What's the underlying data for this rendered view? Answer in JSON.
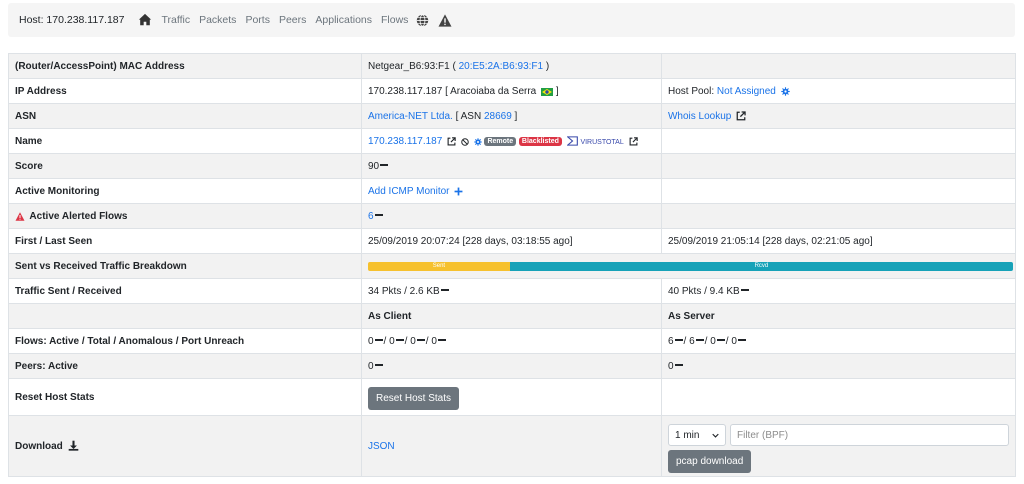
{
  "header": {
    "host_title": "Host: 170.238.117.187",
    "nav": [
      "Traffic",
      "Packets",
      "Ports",
      "Peers",
      "Applications",
      "Flows"
    ]
  },
  "rows": {
    "mac": {
      "label": "(Router/AccessPoint) MAC Address",
      "prefix": "Netgear_B6:93:F1 (",
      "mac": "20:E5:2A:B6:93:F1",
      "suffix": ")"
    },
    "ip": {
      "label": "IP Address",
      "value": "170.238.117.187 [ Aracoiaba da Serra",
      "suffix": "]",
      "pool_label": "Host Pool:",
      "pool_value": "Not Assigned"
    },
    "asn": {
      "label": "ASN",
      "org": "America-NET Ltda.",
      "asn_prefix": "[ ASN",
      "asn_num": "28669",
      "asn_suffix": "]",
      "whois": "Whois Lookup"
    },
    "name": {
      "label": "Name",
      "ip_link": "170.238.117.187",
      "badge_remote": "Remote",
      "badge_blacklisted": "Blacklisted",
      "virustotal": "VIRUSTOTAL"
    },
    "score": {
      "label": "Score",
      "value": "90"
    },
    "monitoring": {
      "label": "Active Monitoring",
      "link": "Add ICMP Monitor"
    },
    "alerted": {
      "label": "Active Alerted Flows",
      "value": "6"
    },
    "seen": {
      "label": "First / Last Seen",
      "first": "25/09/2019 20:07:24 [228 days, 03:18:55 ago]",
      "last": "25/09/2019 21:05:14 [228 days, 02:21:05 ago]"
    },
    "breakdown": {
      "label": "Sent vs Received Traffic Breakdown",
      "sent_label": "Sent",
      "rcvd_label": "Rcvd",
      "sent_fraction": 0.22
    },
    "traffic": {
      "label": "Traffic Sent / Received",
      "sent": "34 Pkts / 2.6 KB",
      "rcvd": "40 Pkts / 9.4 KB"
    },
    "roles": {
      "client": "As Client",
      "server": "As Server"
    },
    "flows": {
      "label": "Flows: Active / Total / Anomalous / Port Unreach",
      "client": [
        "0",
        "0",
        "0",
        "0"
      ],
      "server": [
        "6",
        "6",
        "0",
        "0"
      ]
    },
    "peers": {
      "label": "Peers: Active",
      "client": "0",
      "server": "0"
    },
    "reset": {
      "label": "Reset Host Stats",
      "button": "Reset Host Stats"
    },
    "download": {
      "label": "Download",
      "json": "JSON",
      "duration": "1 min",
      "filter_placeholder": "Filter (BPF)",
      "pcap_button": "pcap download"
    }
  },
  "colors": {
    "link": "#1a73e8",
    "sent": "#f6c12e",
    "rcvd": "#17a2b8",
    "badge_remote": "#6c757d",
    "badge_blacklisted": "#dc3545",
    "warning": "#dc3545"
  },
  "icons": [
    "home-icon",
    "globe-icon",
    "warning-icon",
    "gear-icon",
    "external-link-icon",
    "ban-icon",
    "plus-icon",
    "download-icon",
    "flag-icon",
    "virustotal-icon"
  ]
}
